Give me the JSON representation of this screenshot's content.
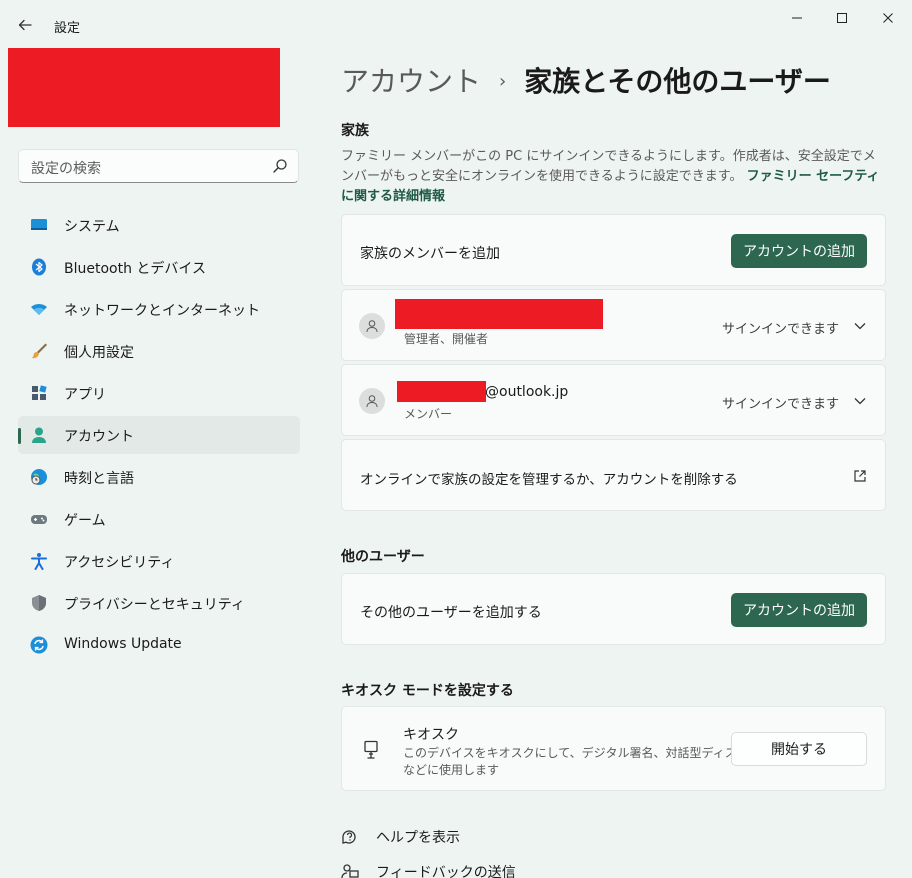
{
  "window": {
    "title": "設定",
    "back_icon": "back-arrow-icon",
    "controls": [
      "minimize-icon",
      "maximize-icon",
      "close-icon"
    ]
  },
  "search": {
    "placeholder": "設定の検索"
  },
  "sidebar": {
    "items": [
      {
        "label": "システム",
        "icon": "system-icon",
        "active": false
      },
      {
        "label": "Bluetooth とデバイス",
        "icon": "bluetooth-icon",
        "active": false
      },
      {
        "label": "ネットワークとインターネット",
        "icon": "network-icon",
        "active": false
      },
      {
        "label": "個人用設定",
        "icon": "brush-icon",
        "active": false
      },
      {
        "label": "アプリ",
        "icon": "apps-icon",
        "active": false
      },
      {
        "label": "アカウント",
        "icon": "account-icon",
        "active": true
      },
      {
        "label": "時刻と言語",
        "icon": "clock-globe-icon",
        "active": false
      },
      {
        "label": "ゲーム",
        "icon": "gamepad-icon",
        "active": false
      },
      {
        "label": "アクセシビリティ",
        "icon": "accessibility-icon",
        "active": false
      },
      {
        "label": "プライバシーとセキュリティ",
        "icon": "shield-icon",
        "active": false
      },
      {
        "label": "Windows Update",
        "icon": "update-icon",
        "active": false
      }
    ]
  },
  "breadcrumb": {
    "parent": "アカウント",
    "separator": "›",
    "current": "家族とその他のユーザー"
  },
  "family": {
    "title": "家族",
    "description": "ファミリー メンバーがこの PC にサインインできるようにします。作成者は、安全設定でメンバーがもっと安全にオンラインを使用できるように設定できます。",
    "link": "ファミリー セーフティに関する詳細情報",
    "add_label": "家族のメンバーを追加",
    "add_button": "アカウントの追加",
    "members": [
      {
        "role": "管理者、開催者",
        "status": "サインインできます"
      },
      {
        "email_suffix": "@outlook.jp",
        "role": "メンバー",
        "status": "サインインできます"
      }
    ],
    "manage_label": "オンラインで家族の設定を管理するか、アカウントを削除する"
  },
  "other_users": {
    "title": "他のユーザー",
    "add_label": "その他のユーザーを追加する",
    "add_button": "アカウントの追加"
  },
  "kiosk": {
    "title": "キオスク モードを設定する",
    "name": "キオスク",
    "description_line1": "このデバイスをキオスクにして、デジタル署名、対話型ディスプレイ",
    "description_line2": "などに使用します",
    "button": "開始する"
  },
  "footer": {
    "help": "ヘルプを表示",
    "feedback": "フィードバックの送信"
  },
  "colors": {
    "accent": "#2e6750",
    "background": "#eef4f1",
    "card": "#f8fbfa",
    "redaction": "#ed1c24"
  }
}
